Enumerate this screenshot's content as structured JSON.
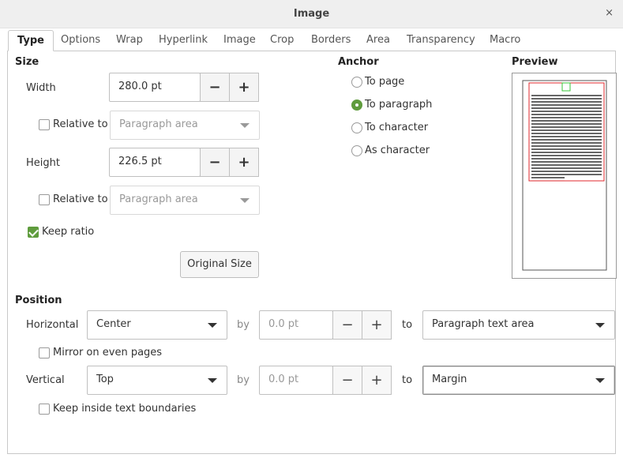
{
  "window": {
    "title": "Image",
    "close_glyph": "×"
  },
  "tabs": [
    {
      "label": "Type",
      "active": true
    },
    {
      "label": "Options"
    },
    {
      "label": "Wrap"
    },
    {
      "label": "Hyperlink"
    },
    {
      "label": "Image"
    },
    {
      "label": "Crop"
    },
    {
      "label": "Borders"
    },
    {
      "label": "Area"
    },
    {
      "label": "Transparency"
    },
    {
      "label": "Macro"
    }
  ],
  "size": {
    "heading": "Size",
    "width_label": "Width",
    "width_value": "280.0 pt",
    "height_label": "Height",
    "height_value": "226.5 pt",
    "relative_to_label": "Relative to",
    "relative_width_option": "Paragraph area",
    "relative_height_option": "Paragraph area",
    "keep_ratio_label": "Keep ratio",
    "keep_ratio_checked": true,
    "original_size_label": "Original Size",
    "minus": "−",
    "plus": "+"
  },
  "anchor": {
    "heading": "Anchor",
    "options": [
      "To page",
      "To paragraph",
      "To character",
      "As character"
    ],
    "selected": "To paragraph"
  },
  "preview": {
    "heading": "Preview"
  },
  "position": {
    "heading": "Position",
    "horizontal_label": "Horizontal",
    "horizontal_value": "Center",
    "horizontal_by_label": "by",
    "horizontal_by_value": "0.0 pt",
    "horizontal_to_label": "to",
    "horizontal_to_value": "Paragraph text area",
    "mirror_label": "Mirror on even pages",
    "vertical_label": "Vertical",
    "vertical_value": "Top",
    "vertical_by_label": "by",
    "vertical_by_value": "0.0 pt",
    "vertical_to_label": "to",
    "vertical_to_value": "Margin",
    "keep_inside_label": "Keep inside text boundaries"
  },
  "colors": {
    "accent": "#5f9c3d",
    "preview_border": "#e0282e",
    "preview_anchor": "#39c439"
  }
}
